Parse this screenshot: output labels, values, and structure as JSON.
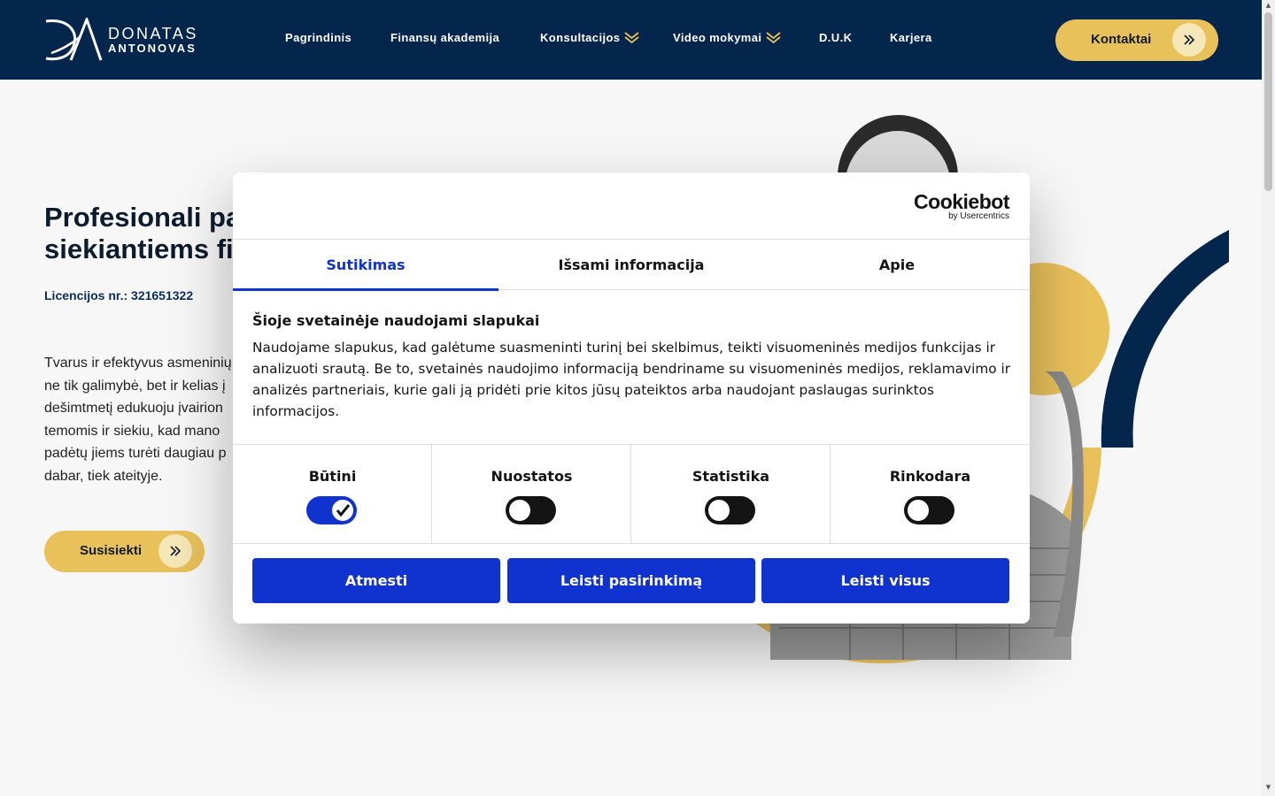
{
  "header": {
    "logo": {
      "line1": "DONATAS",
      "line2": "ANTONOVAS"
    },
    "nav": [
      {
        "label": "Pagrindinis",
        "has_dropdown": false
      },
      {
        "label": "Finansų akademija",
        "has_dropdown": false
      },
      {
        "label": "Konsultacijos",
        "has_dropdown": true
      },
      {
        "label": "Video mokymai",
        "has_dropdown": true
      },
      {
        "label": "D.U.K",
        "has_dropdown": false
      },
      {
        "label": "Karjera",
        "has_dropdown": false
      }
    ],
    "contact_label": "Kontaktai"
  },
  "hero": {
    "title_line1": "Profesionali pa",
    "title_line2": "siekiantiems fi",
    "license": "Licencijos nr.: 321651322",
    "text_lines": [
      "Tvarus ir efektyvus asmeninių",
      "ne tik galimybė, bet ir kelias į",
      "dešimtmetį edukuoju įvairion",
      "temomis ir siekiu, kad mano",
      "padėtų jiems turėti daugiau p",
      "dabar, tiek ateityje."
    ],
    "cta_label": "Susisiekti"
  },
  "cookie_dialog": {
    "brand": "Cookiebot",
    "brand_sub": "by Usercentrics",
    "tabs": [
      {
        "label": "Sutikimas",
        "active": true
      },
      {
        "label": "Išsami informacija",
        "active": false
      },
      {
        "label": "Apie",
        "active": false
      }
    ],
    "heading": "Šioje svetainėje naudojami slapukai",
    "body": "Naudojame slapukus, kad galėtume suasmeninti turinį bei skelbimus, teikti visuomeninės medijos funkcijas ir analizuoti srautą. Be to, svetainės naudojimo informaciją bendriname su visuomeninės medijos, reklamavimo ir analizės partneriais, kurie gali ją pridėti prie kitos jūsų pateiktos arba naudojant paslaugas surinktos informacijos.",
    "toggles": [
      {
        "label": "Būtini",
        "checked": true
      },
      {
        "label": "Nuostatos",
        "checked": false
      },
      {
        "label": "Statistika",
        "checked": false
      },
      {
        "label": "Rinkodara",
        "checked": false
      }
    ],
    "buttons": {
      "reject": "Atmesti",
      "allow_selection": "Leisti pasirinkimą",
      "allow_all": "Leisti visus"
    }
  },
  "colors": {
    "navy": "#04254c",
    "gold": "#e9c15b",
    "cookie_blue": "#1032cf"
  }
}
